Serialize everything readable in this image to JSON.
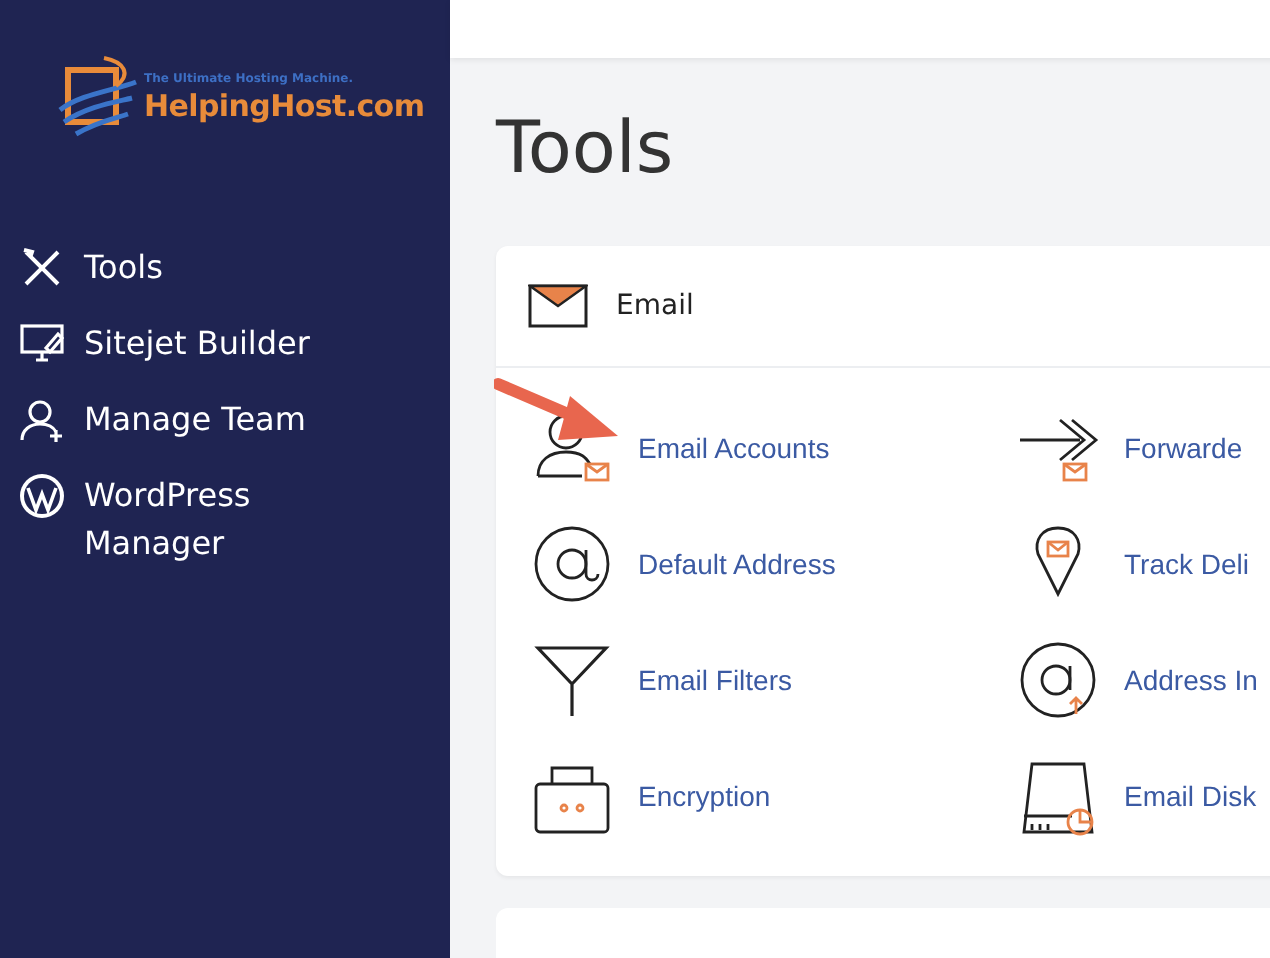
{
  "logo": {
    "tagline": "The Ultimate Hosting Machine.",
    "name": "HelpingHost.com"
  },
  "sidebar": {
    "items": [
      {
        "label": "Tools"
      },
      {
        "label": "Sitejet Builder"
      },
      {
        "label": "Manage Team"
      },
      {
        "label": "WordPress Manager"
      }
    ]
  },
  "page": {
    "title": "Tools"
  },
  "email_section": {
    "title": "Email",
    "items": [
      {
        "label": "Email Accounts"
      },
      {
        "label": "Forwarde"
      },
      {
        "label": "Default Address"
      },
      {
        "label": "Track Deli"
      },
      {
        "label": "Email Filters"
      },
      {
        "label": "Address In"
      },
      {
        "label": "Encryption"
      },
      {
        "label": "Email Disk"
      }
    ]
  }
}
